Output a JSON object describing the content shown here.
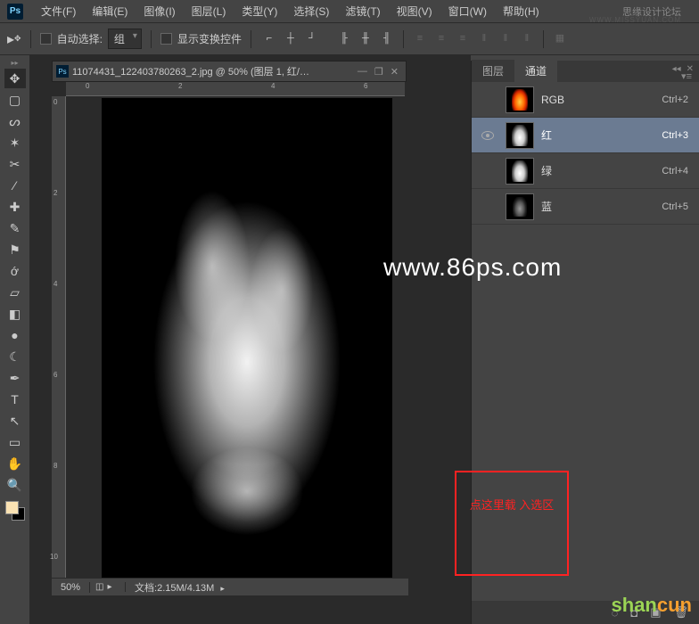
{
  "app": {
    "logo": "Ps"
  },
  "brand": {
    "name": "思缘设计论坛",
    "url": "WWW.MISSYUAN.COM"
  },
  "menu": [
    "文件(F)",
    "编辑(E)",
    "图像(I)",
    "图层(L)",
    "类型(Y)",
    "选择(S)",
    "滤镜(T)",
    "视图(V)",
    "窗口(W)",
    "帮助(H)"
  ],
  "options": {
    "auto_select_label": "自动选择:",
    "auto_select_value": "组",
    "show_transform_label": "显示变换控件"
  },
  "document": {
    "title": "11074431_122403780263_2.jpg @ 50% (图层 1, 红/…",
    "zoom": "50%",
    "info_label": "文档",
    "info_value": ":2.15M/4.13M"
  },
  "ruler_h": [
    "0",
    "2",
    "4",
    "6"
  ],
  "ruler_v": [
    "0",
    "2",
    "4",
    "6",
    "8",
    "10"
  ],
  "panels": {
    "tab_layers": "图层",
    "tab_channels": "通道"
  },
  "channels": [
    {
      "name": "RGB",
      "shortcut": "Ctrl+2",
      "visible": false,
      "selected": false,
      "thumb": "rgb"
    },
    {
      "name": "红",
      "shortcut": "Ctrl+3",
      "visible": true,
      "selected": true,
      "thumb": "bw"
    },
    {
      "name": "绿",
      "shortcut": "Ctrl+4",
      "visible": false,
      "selected": false,
      "thumb": "bw"
    },
    {
      "name": "蓝",
      "shortcut": "Ctrl+5",
      "visible": false,
      "selected": false,
      "thumb": "dim"
    }
  ],
  "annotation": {
    "text": "点这里载\n入选区"
  },
  "watermarks": {
    "main": "www.86ps.com",
    "corner_a": "shan",
    "corner_b": "cun"
  },
  "colors": {
    "foreground": "#fae2b3",
    "background": "#000000",
    "selected_row": "#6b7b92",
    "annotation": "#ff2222"
  }
}
